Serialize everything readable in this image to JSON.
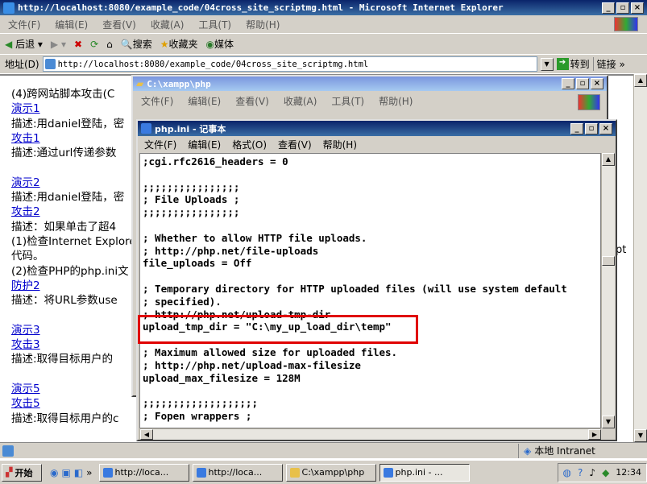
{
  "ie": {
    "title": "http://localhost:8080/example_code/04cross_site_scriptmg.html - Microsoft Internet Explorer",
    "menu": [
      "文件(F)",
      "编辑(E)",
      "查看(V)",
      "收藏(A)",
      "工具(T)",
      "帮助(H)"
    ],
    "toolbar": {
      "back": "后退",
      "search": "搜索",
      "favorites": "收藏夹",
      "media": "媒体"
    },
    "address_label": "地址(D)",
    "address": "http://localhost:8080/example_code/04cross_site_scriptmg.html",
    "go": "转到",
    "links": "链接",
    "page": {
      "lines": [
        {
          "t": "(4)跨网站脚本攻击(C",
          "link": false
        },
        {
          "t": "演示1",
          "link": true
        },
        {
          "t": "描述:用daniel登陆，密",
          "link": false
        },
        {
          "t": "攻击1",
          "link": true
        },
        {
          "t": "描述:通过url传递参数",
          "link": false
        },
        {
          "t": "",
          "link": false
        },
        {
          "t": "演示2",
          "link": true
        },
        {
          "t": "描述:用daniel登陆，密",
          "link": false
        },
        {
          "t": "攻击2",
          "link": true
        },
        {
          "t": "描述：如果单击了超4",
          "link": false
        },
        {
          "t": "(1)检查Internet Explore",
          "link": false
        },
        {
          "t": "代码。",
          "link": false
        },
        {
          "t": "(2)检查PHP的php.ini文",
          "link": false
        },
        {
          "t": "防护2",
          "link": true
        },
        {
          "t": "描述：将URL参数use",
          "link": false
        },
        {
          "t": "",
          "link": false
        },
        {
          "t": "演示3",
          "link": true
        },
        {
          "t": "攻击3",
          "link": true
        },
        {
          "t": "描述:取得目标用户的",
          "link": false
        },
        {
          "t": "",
          "link": false
        },
        {
          "t": "演示5",
          "link": true
        },
        {
          "t": "攻击5",
          "link": true
        },
        {
          "t": "描述:取得目标用户的c",
          "link": false
        }
      ],
      "right_fragment": "pt"
    },
    "status": "本地 Intranet"
  },
  "explorer": {
    "title": "C:\\xampp\\php",
    "menu": [
      "文件(F)",
      "编辑(E)",
      "查看(V)",
      "收藏(A)",
      "工具(T)",
      "帮助(H)"
    ]
  },
  "notepad": {
    "title": "php.ini - 记事本",
    "menu": [
      "文件(F)",
      "编辑(E)",
      "格式(O)",
      "查看(V)",
      "帮助(H)"
    ],
    "lines": [
      ";cgi.rfc2616_headers = 0",
      "",
      ";;;;;;;;;;;;;;;;",
      "; File Uploads ;",
      ";;;;;;;;;;;;;;;;",
      "",
      "; Whether to allow HTTP file uploads.",
      "; http://php.net/file-uploads",
      "file_uploads = Off",
      "",
      "; Temporary directory for HTTP uploaded files (will use system default",
      "; specified).",
      "; http://php.net/upload-tmp-dir",
      "upload_tmp_dir = \"C:\\my_up_load_dir\\temp\"",
      "",
      "; Maximum allowed size for uploaded files.",
      "; http://php.net/upload-max-filesize",
      "upload_max_filesize = 128M",
      "",
      ";;;;;;;;;;;;;;;;;;;",
      "; Fopen wrappers ;"
    ],
    "highlight_color": "#e00000"
  },
  "taskbar": {
    "start": "开始",
    "tasks": [
      "http://loca...",
      "http://loca...",
      "C:\\xampp\\php",
      "php.ini - ..."
    ],
    "clock": "12:34"
  }
}
